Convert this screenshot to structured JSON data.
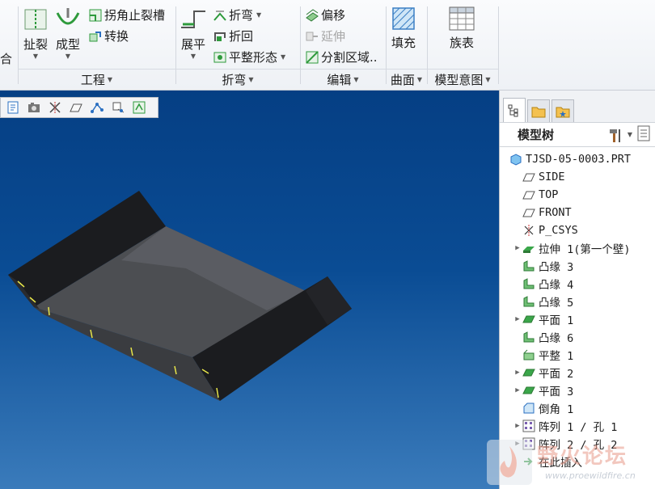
{
  "ribbon": {
    "partial_left_label": "合",
    "tools": {
      "rip": "扯裂",
      "form": "成型",
      "corner_relief": "拐角止裂槽",
      "convert": "转换",
      "unbend": "展平",
      "bend": "折弯",
      "bend_back": "折回",
      "flatten_form": "平整形态",
      "offset": "偏移",
      "extend": "延伸",
      "split_area": "分割区域..",
      "fill": "填充",
      "family_table": "族表"
    },
    "groups": {
      "engineering": "工程",
      "bends": "折弯",
      "edit": "编辑",
      "surfaces": "曲面",
      "model_intent": "模型意图"
    }
  },
  "model_tree": {
    "title": "模型树",
    "items": [
      {
        "label": "TJSD-05-0003.PRT",
        "icon": "part-icon",
        "indent": 0,
        "expand": false
      },
      {
        "label": "SIDE",
        "icon": "datum-plane-icon",
        "indent": 1,
        "expand": false
      },
      {
        "label": "TOP",
        "icon": "datum-plane-icon",
        "indent": 1,
        "expand": false
      },
      {
        "label": "FRONT",
        "icon": "datum-plane-icon",
        "indent": 1,
        "expand": false
      },
      {
        "label": "P_CSYS",
        "icon": "csys-icon",
        "indent": 1,
        "expand": false
      },
      {
        "label": "拉伸 1(第一个壁)",
        "icon": "extrude-wall-icon",
        "indent": 1,
        "expand": true
      },
      {
        "label": "凸缘 3",
        "icon": "flange-icon",
        "indent": 1,
        "expand": false
      },
      {
        "label": "凸缘 4",
        "icon": "flange-icon",
        "indent": 1,
        "expand": false
      },
      {
        "label": "凸缘 5",
        "icon": "flange-icon",
        "indent": 1,
        "expand": false
      },
      {
        "label": "平面 1",
        "icon": "planar-wall-icon",
        "indent": 1,
        "expand": true
      },
      {
        "label": "凸缘 6",
        "icon": "flange-icon",
        "indent": 1,
        "expand": false
      },
      {
        "label": "平整 1",
        "icon": "flat-wall-icon",
        "indent": 1,
        "expand": false
      },
      {
        "label": "平面 2",
        "icon": "planar-wall-icon",
        "indent": 1,
        "expand": true
      },
      {
        "label": "平面 3",
        "icon": "planar-wall-icon",
        "indent": 1,
        "expand": true
      },
      {
        "label": "倒角 1",
        "icon": "chamfer-icon",
        "indent": 1,
        "expand": false
      },
      {
        "label": "阵列 1 / 孔 1",
        "icon": "pattern-icon",
        "indent": 1,
        "expand": true
      },
      {
        "label": "阵列 2 / 孔 2",
        "icon": "pattern-icon",
        "indent": 1,
        "expand": true
      },
      {
        "label": "在此插入",
        "icon": "insert-here-icon",
        "indent": 1,
        "expand": false
      }
    ]
  },
  "watermark": {
    "title": "野火论坛",
    "url": "www.proewildfire.cn"
  },
  "colors": {
    "accent": "#2e9a3c",
    "viewport_top": "#053f84",
    "viewport_bottom": "#3a7bbb"
  }
}
